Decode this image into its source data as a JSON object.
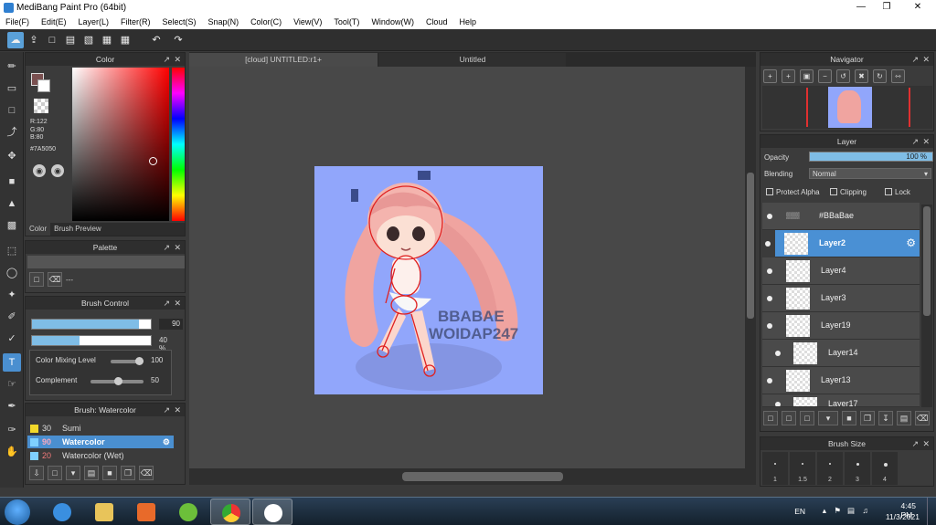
{
  "window": {
    "title": "MediBang Paint Pro (64bit)"
  },
  "menu": [
    "File(F)",
    "Edit(E)",
    "Layer(L)",
    "Filter(R)",
    "Select(S)",
    "Snap(N)",
    "Color(C)",
    "View(V)",
    "Tool(T)",
    "Window(W)",
    "Cloud",
    "Help"
  ],
  "color_panel": {
    "title": "Color",
    "r": "R:122",
    "g": "G:80",
    "b": "B:80",
    "hex": "#7A5050",
    "tabs": [
      "Color",
      "Brush Preview"
    ]
  },
  "palette": {
    "title": "Palette",
    "dash": "---"
  },
  "brush_control": {
    "title": "Brush Control",
    "size_value": "90",
    "size_fill": 0.9,
    "opacity_value": "40 %",
    "opacity_fill": 0.4,
    "color_mixing_label": "Color Mixing Level",
    "color_mixing_value": "100",
    "complement_label": "Complement",
    "complement_value": "50"
  },
  "brush_list": {
    "title": "Brush: Watercolor",
    "items": [
      {
        "size": "30",
        "name": "Sumi",
        "color": "#f2d82a"
      },
      {
        "size": "90",
        "name": "Watercolor",
        "color": "#7fd0ff",
        "selected": true
      },
      {
        "size": "20",
        "name": "Watercolor (Wet)",
        "color": "#7fd0ff"
      }
    ]
  },
  "documents": {
    "tab1": "[cloud] UNTITLED:r1+",
    "tab2": "Untitled"
  },
  "artwork": {
    "background": "#91a6fb",
    "watermark_line1": "BBABAE",
    "watermark_line2": "WOIDAP247"
  },
  "navigator": {
    "title": "Navigator"
  },
  "layer_panel": {
    "title": "Layer",
    "opacity_label": "Opacity",
    "opacity_value": "100 %",
    "blending_label": "Blending",
    "blending_value": "Normal",
    "protect_alpha": "Protect Alpha",
    "clipping": "Clipping",
    "lock": "Lock",
    "layers": [
      "#BBaBae",
      "Layer2",
      "Layer4",
      "Layer3",
      "Layer19",
      "Layer14",
      "Layer13",
      "Layer17"
    ],
    "selected": "Layer2"
  },
  "brush_size": {
    "title": "Brush Size",
    "sizes": [
      "1",
      "1.5",
      "2",
      "3",
      "4"
    ]
  },
  "taskbar": {
    "lang": "EN",
    "time": "4:45 PM",
    "date": "11/3/2021"
  }
}
